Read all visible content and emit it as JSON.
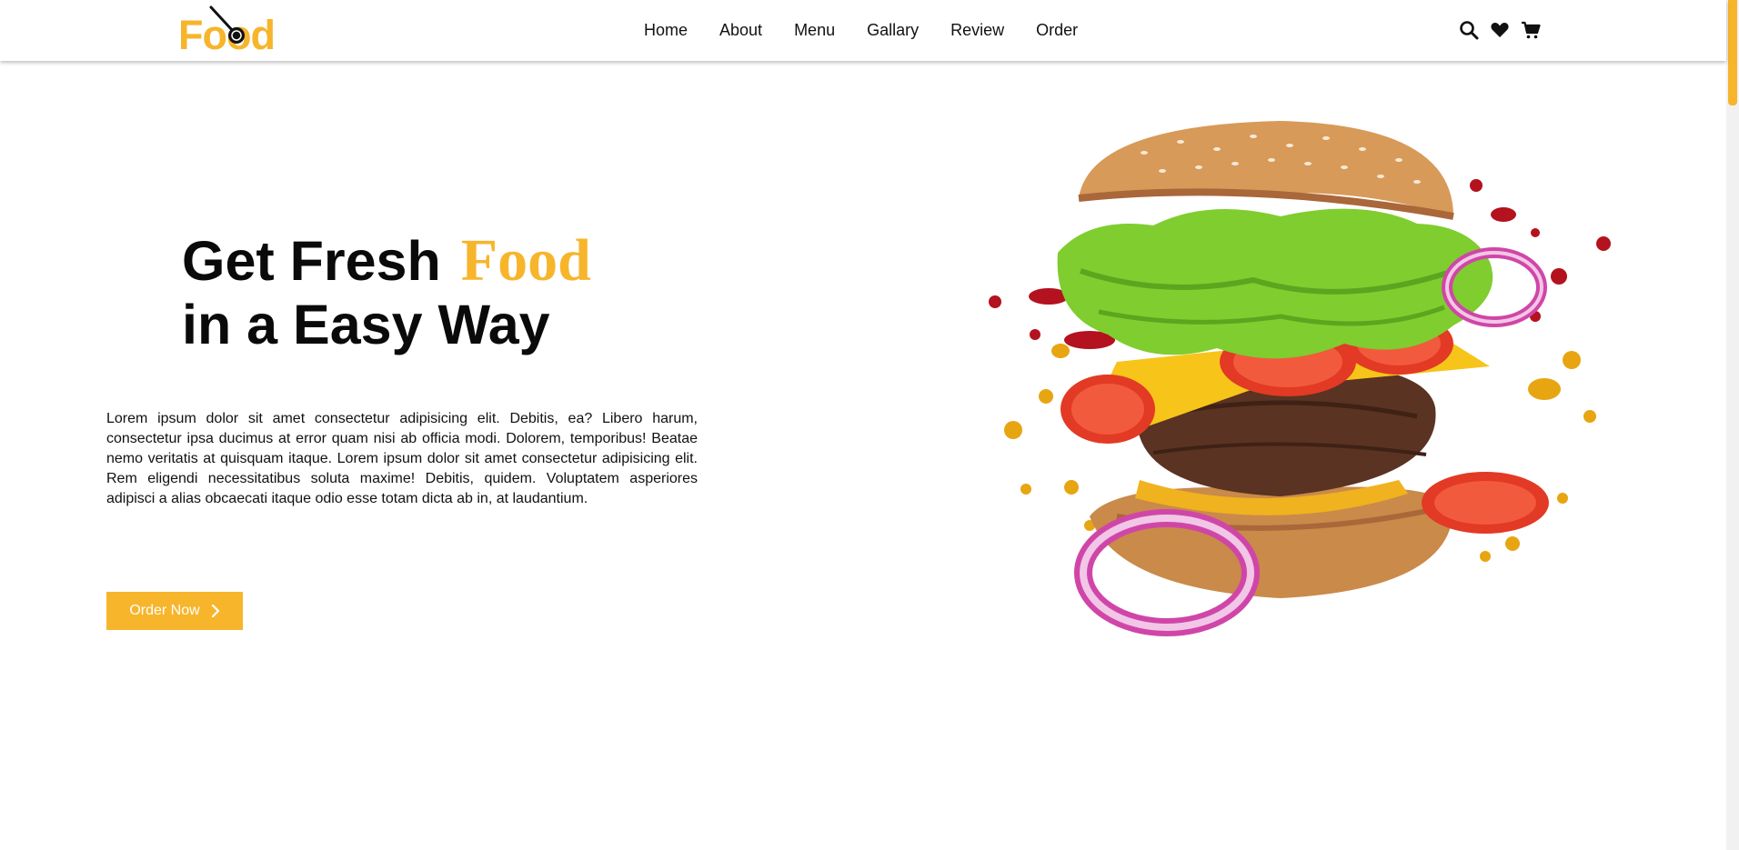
{
  "brand": {
    "logo_text": "Food",
    "accent_color": "#f7b52c"
  },
  "nav": {
    "items": [
      {
        "label": "Home"
      },
      {
        "label": "About"
      },
      {
        "label": "Menu"
      },
      {
        "label": "Gallary"
      },
      {
        "label": "Review"
      },
      {
        "label": "Order"
      }
    ]
  },
  "header_icons": [
    "search-icon",
    "heart-icon",
    "cart-icon"
  ],
  "hero": {
    "title_part1": "Get Fresh",
    "title_accent": "Food",
    "title_line2": "in a Easy Way",
    "description": "Lorem ipsum dolor sit amet consectetur adipisicing elit. Debitis, ea? Libero harum, consectetur ipsa ducimus at error quam nisi ab officia modi. Dolorem, temporibus! Beatae nemo veritatis at quisquam itaque. Lorem ipsum dolor sit amet consectetur adipisicing elit. Rem eligendi necessitatibus soluta maxime! Debitis, quidem. Voluptatem asperiores adipisci a alias obcaecati itaque odio esse totam dicta ab in, at laudantium.",
    "cta_label": "Order Now",
    "cta_icon": "chevron-right-icon",
    "image": "burger-image"
  }
}
